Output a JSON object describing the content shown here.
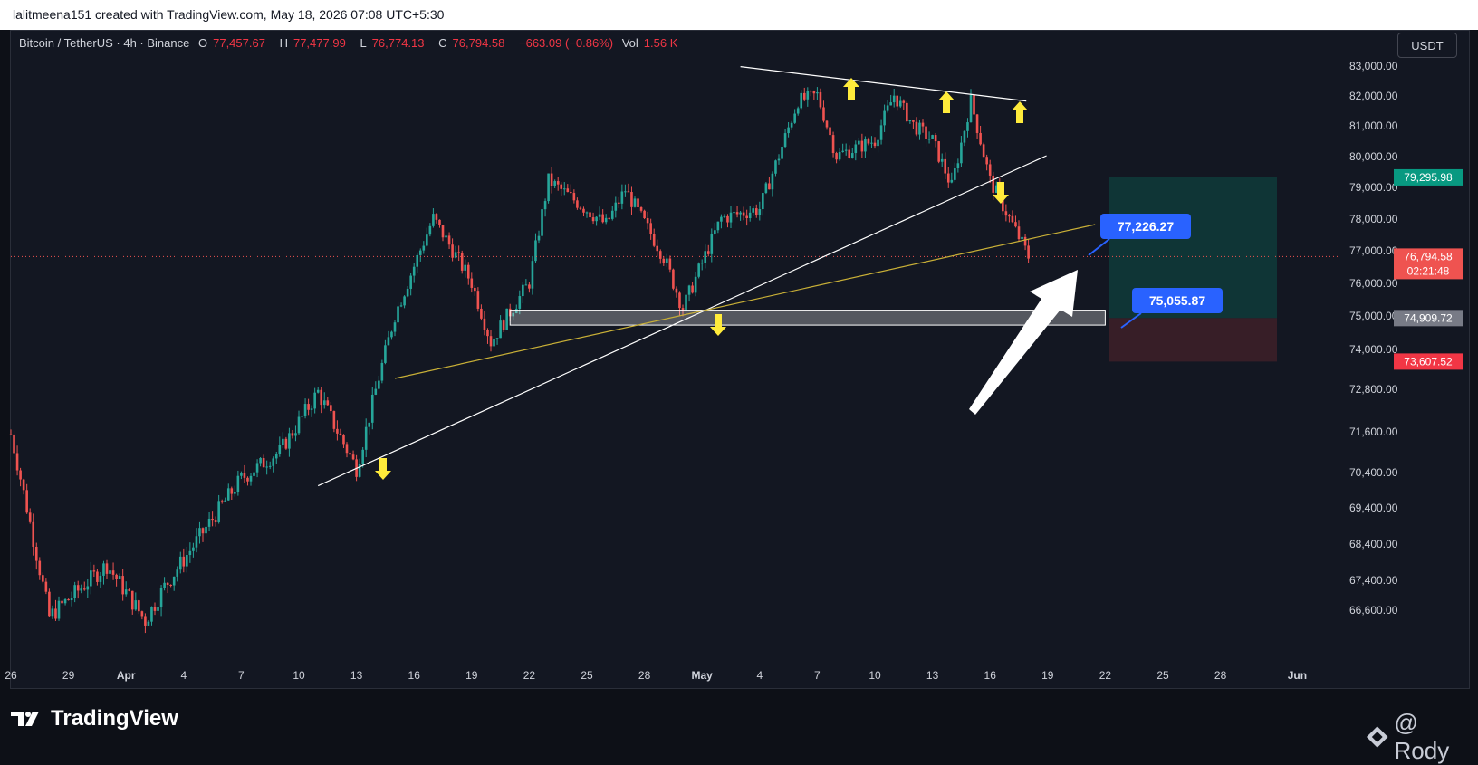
{
  "header": {
    "author_line": "lalitmeena151 created with TradingView.com, May 18, 2026 07:08 UTC+5:30"
  },
  "legend": {
    "symbol": "Bitcoin / TetherUS · 4h · Binance",
    "open_key": "O",
    "open": "77,457.67",
    "high_key": "H",
    "high": "77,477.99",
    "low_key": "L",
    "low": "76,774.13",
    "close_key": "C",
    "close": "76,794.58",
    "change": "−663.09 (−0.86%)",
    "vol_key": "Vol",
    "vol": "1.56 K"
  },
  "currency_button": "USDT",
  "branding": {
    "logo_text": "TradingView",
    "watermark": "@ Rody"
  },
  "colors": {
    "background": "#131722",
    "up": "#26a69a",
    "down": "#ef5350",
    "arrow": "#ffeb3b",
    "label_blue": "#2962ff",
    "tp_zone": "#0f3b3a",
    "sl_zone": "#3c1f28"
  },
  "chart_data": {
    "type": "candlestick",
    "interval": "4h",
    "x_tick_labels": [
      "26",
      "29",
      "Apr",
      "4",
      "7",
      "10",
      "13",
      "16",
      "19",
      "22",
      "25",
      "28",
      "May",
      "4",
      "7",
      "10",
      "13",
      "16",
      "19",
      "22",
      "25",
      "28",
      "Jun"
    ],
    "y_tick_labels": [
      "83,000.00",
      "82,000.00",
      "81,000.00",
      "80,000.00",
      "79,000.00",
      "78,000.00",
      "77,000.00",
      "76,000.00",
      "75,000.00",
      "74,000.00",
      "72,800.00",
      "71,600.00",
      "70,400.00",
      "69,400.00",
      "68,400.00",
      "67,400.00",
      "66,600.00"
    ],
    "y_axis_range": [
      66300,
      83400
    ],
    "price_path_keypoints": [
      {
        "date": "Mar 26",
        "price": 71500
      },
      {
        "date": "Mar 28",
        "price": 66400
      },
      {
        "date": "Mar 31",
        "price": 67800
      },
      {
        "date": "Apr 2",
        "price": 66300
      },
      {
        "date": "Apr 3",
        "price": 67200
      },
      {
        "date": "Apr 7",
        "price": 70200
      },
      {
        "date": "Apr 9",
        "price": 71000
      },
      {
        "date": "Apr 11",
        "price": 72700
      },
      {
        "date": "Apr 13",
        "price": 70500
      },
      {
        "date": "Apr 15",
        "price": 75000
      },
      {
        "date": "Apr 17",
        "price": 78000
      },
      {
        "date": "Apr 19",
        "price": 76000
      },
      {
        "date": "Apr 20",
        "price": 74200
      },
      {
        "date": "Apr 22",
        "price": 76000
      },
      {
        "date": "Apr 23",
        "price": 79200
      },
      {
        "date": "Apr 26",
        "price": 77800
      },
      {
        "date": "Apr 27",
        "price": 78900
      },
      {
        "date": "Apr 29",
        "price": 76800
      },
      {
        "date": "Apr 30",
        "price": 75200
      },
      {
        "date": "May 2",
        "price": 78000
      },
      {
        "date": "May 4",
        "price": 78300
      },
      {
        "date": "May 5",
        "price": 80000
      },
      {
        "date": "May 6",
        "price": 81800
      },
      {
        "date": "May 7",
        "price": 82000
      },
      {
        "date": "May 8",
        "price": 80000
      },
      {
        "date": "May 10",
        "price": 80500
      },
      {
        "date": "May 11",
        "price": 82000
      },
      {
        "date": "May 12",
        "price": 81000
      },
      {
        "date": "May 13",
        "price": 80500
      },
      {
        "date": "May 14",
        "price": 79000
      },
      {
        "date": "May 15",
        "price": 81800
      },
      {
        "date": "May 16",
        "price": 79200
      },
      {
        "date": "May 17",
        "price": 78000
      },
      {
        "date": "May 18",
        "price": 76800
      }
    ],
    "price_tags": {
      "take_profit": "79,295.98",
      "last_price": "76,794.58",
      "countdown": "02:21:48",
      "entry": "74,909.72",
      "stop_loss": "73,607.52"
    },
    "callouts": [
      "77,226.27",
      "75,055.87"
    ],
    "annotations": [
      "descending resistance line across three tops",
      "rising trendline from Apr 13 low",
      "yellow rising support line",
      "support zone rectangle near 75,000",
      "long position zones: target 79,295.98, stop 73,607.52",
      "large white arrow pointing up",
      "yellow arrow markers at tops and bottoms"
    ]
  }
}
